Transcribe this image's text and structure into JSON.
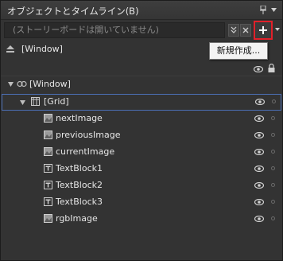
{
  "panel": {
    "title": "オブジェクトとタイムライン(B)"
  },
  "storyboard": {
    "placeholder": "(ストーリーボードは開いていません)",
    "tooltip": "新規作成..."
  },
  "scope": {
    "label": "[Window]"
  },
  "tree": [
    {
      "label": "[Window]",
      "level": 0,
      "expanded": true,
      "icon": "window-icon"
    },
    {
      "label": "[Grid]",
      "level": 1,
      "expanded": true,
      "icon": "grid-icon",
      "selected": true
    },
    {
      "label": "nextImage",
      "level": 2,
      "icon": "image-icon"
    },
    {
      "label": "previousImage",
      "level": 2,
      "icon": "image-icon"
    },
    {
      "label": "currentImage",
      "level": 2,
      "icon": "image-icon"
    },
    {
      "label": "TextBlock1",
      "level": 2,
      "icon": "textblock-icon"
    },
    {
      "label": "TextBlock2",
      "level": 2,
      "icon": "textblock-icon"
    },
    {
      "label": "TextBlock3",
      "level": 2,
      "icon": "textblock-icon"
    },
    {
      "label": "rgbImage",
      "level": 2,
      "icon": "image-icon"
    }
  ]
}
